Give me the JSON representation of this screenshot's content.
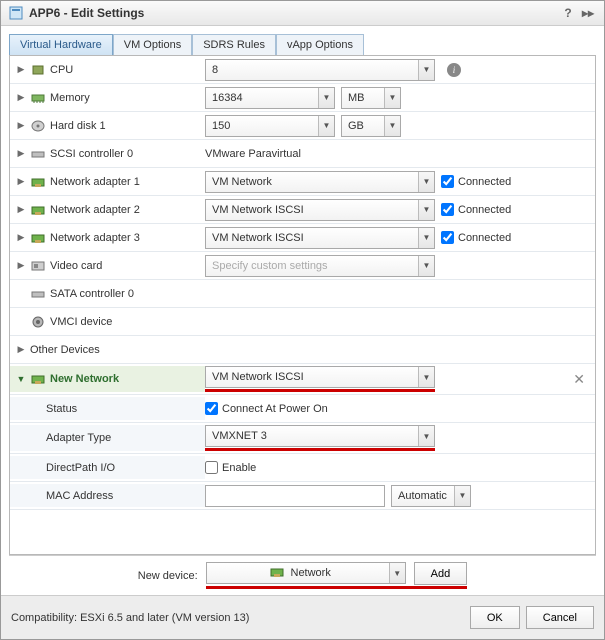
{
  "title": "APP6 - Edit Settings",
  "tabs": [
    "Virtual Hardware",
    "VM Options",
    "SDRS Rules",
    "vApp Options"
  ],
  "active_tab": 0,
  "rows": {
    "cpu": {
      "label": "CPU",
      "value": "8"
    },
    "memory": {
      "label": "Memory",
      "value": "16384",
      "unit": "MB"
    },
    "hdd1": {
      "label": "Hard disk 1",
      "value": "150",
      "unit": "GB"
    },
    "scsi0": {
      "label": "SCSI controller 0",
      "value": "VMware Paravirtual"
    },
    "nic1": {
      "label": "Network adapter 1",
      "value": "VM Network",
      "connected": true,
      "connected_label": "Connected"
    },
    "nic2": {
      "label": "Network adapter 2",
      "value": "VM Network ISCSI",
      "connected": true,
      "connected_label": "Connected"
    },
    "nic3": {
      "label": "Network adapter 3",
      "value": "VM Network ISCSI",
      "connected": true,
      "connected_label": "Connected"
    },
    "video": {
      "label": "Video card",
      "value": "Specify custom settings"
    },
    "sata0": {
      "label": "SATA controller 0"
    },
    "vmci": {
      "label": "VMCI device"
    },
    "other": {
      "label": "Other Devices"
    }
  },
  "new_network": {
    "label": "New Network",
    "network_value": "VM Network ISCSI",
    "status_label": "Status",
    "status_check_label": "Connect At Power On",
    "status_checked": true,
    "adapter_label": "Adapter Type",
    "adapter_value": "VMXNET 3",
    "dpio_label": "DirectPath I/O",
    "dpio_check_label": "Enable",
    "dpio_checked": false,
    "mac_label": "MAC Address",
    "mac_value": "",
    "mac_mode": "Automatic"
  },
  "new_device": {
    "label": "New device:",
    "value": "Network",
    "add_label": "Add"
  },
  "footer": {
    "compat": "Compatibility: ESXi 6.5 and later (VM version 13)",
    "ok": "OK",
    "cancel": "Cancel"
  }
}
